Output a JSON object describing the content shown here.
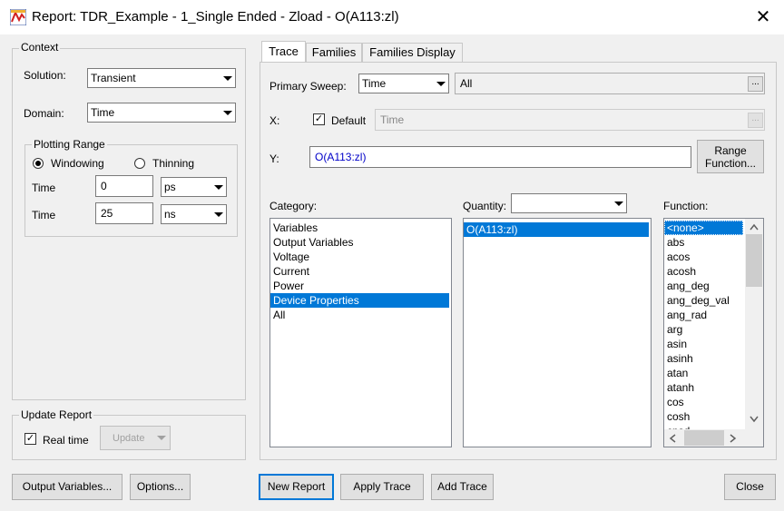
{
  "window": {
    "title": "Report: TDR_Example - 1_Single Ended - Zload - O(A113:zl)",
    "close_glyph": "✕"
  },
  "context": {
    "group_label": "Context",
    "solution_label": "Solution:",
    "solution_value": "Transient",
    "domain_label": "Domain:",
    "domain_value": "Time",
    "plotting_range": {
      "group_label": "Plotting Range",
      "windowing_label": "Windowing",
      "thinning_label": "Thinning",
      "time1_label": "Time",
      "time1_value": "0",
      "time1_unit": "ps",
      "time2_label": "Time",
      "time2_value": "25",
      "time2_unit": "ns"
    }
  },
  "update_report": {
    "group_label": "Update Report",
    "realtime_label": "Real time",
    "update_button": "Update"
  },
  "tabs": [
    {
      "label": "Trace"
    },
    {
      "label": "Families"
    },
    {
      "label": "Families Display"
    }
  ],
  "trace": {
    "primary_sweep_label": "Primary Sweep:",
    "primary_sweep_value": "Time",
    "primary_sweep_range": "All",
    "x_label": "X:",
    "default_label": "Default",
    "x_value": "Time",
    "y_label": "Y:",
    "y_value": "O(A113:zl)",
    "range_function_line1": "Range",
    "range_function_line2": "Function...",
    "dots": "...",
    "category_label": "Category:",
    "categories": [
      "Variables",
      "Output Variables",
      "Voltage",
      "Current",
      "Power",
      "Device Properties",
      "All"
    ],
    "quantity_label": "Quantity:",
    "quantities": [
      "O(A113:zl)"
    ],
    "function_label": "Function:",
    "functions": [
      "<none>",
      "abs",
      "acos",
      "acosh",
      "ang_deg",
      "ang_deg_val",
      "ang_rad",
      "arg",
      "asin",
      "asinh",
      "atan",
      "atanh",
      "cos",
      "cosh",
      "cpsd"
    ]
  },
  "buttons": {
    "output_variables": "Output Variables...",
    "options": "Options...",
    "new_report": "New Report",
    "apply_trace": "Apply Trace",
    "add_trace": "Add Trace",
    "close": "Close"
  },
  "colors": {
    "selection": "#0078d7",
    "y_text": "#0000c8"
  }
}
